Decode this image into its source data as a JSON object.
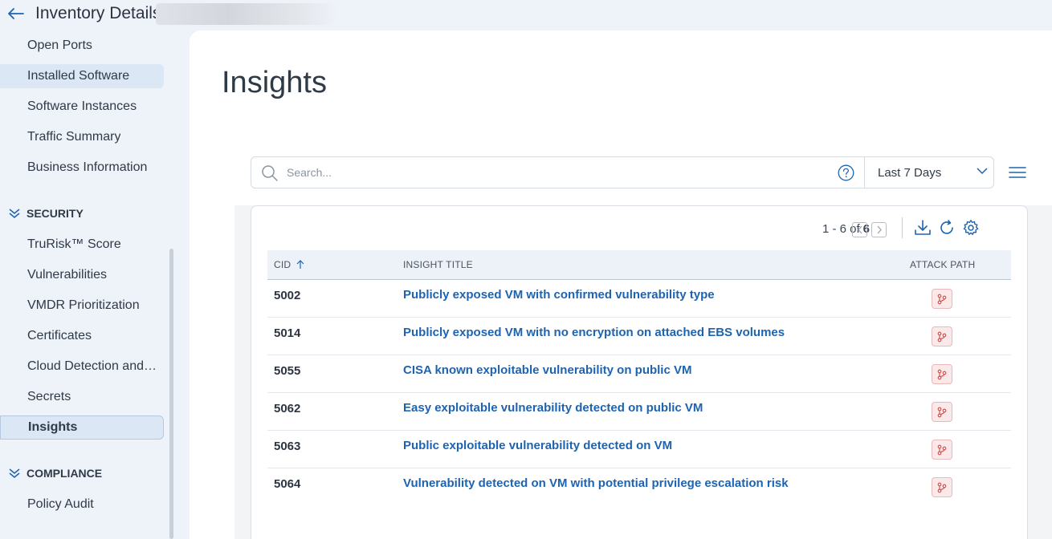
{
  "header": {
    "title": "Inventory Details:"
  },
  "sidebar": {
    "items_top": [
      {
        "label": "Open Ports"
      },
      {
        "label": "Installed Software"
      },
      {
        "label": "Software Instances"
      },
      {
        "label": "Traffic Summary"
      },
      {
        "label": "Business Information"
      }
    ],
    "security_label": "SECURITY",
    "security_items": [
      {
        "label": "TruRisk™ Score"
      },
      {
        "label": "Vulnerabilities"
      },
      {
        "label": "VMDR Prioritization"
      },
      {
        "label": "Certificates"
      },
      {
        "label": "Cloud Detection and Response"
      },
      {
        "label": "Secrets"
      },
      {
        "label": "Insights"
      }
    ],
    "compliance_label": "COMPLIANCE",
    "compliance_items": [
      {
        "label": "Policy Audit"
      }
    ]
  },
  "main": {
    "page_title": "Insights",
    "search": {
      "placeholder": "Search...",
      "value": ""
    },
    "date_range": "Last 7 Days",
    "pager": {
      "range": "1 - 6 of",
      "total": "6"
    },
    "table": {
      "columns": {
        "cid": "CID",
        "title": "INSIGHT TITLE",
        "attack": "ATTACK PATH"
      },
      "rows": [
        {
          "cid": "5002",
          "title": "Publicly exposed VM with confirmed vulnerability type"
        },
        {
          "cid": "5014",
          "title": "Publicly exposed VM with no encryption on attached EBS volumes"
        },
        {
          "cid": "5055",
          "title": "CISA known exploitable vulnerability on public VM"
        },
        {
          "cid": "5062",
          "title": "Easy exploitable vulnerability detected on public VM"
        },
        {
          "cid": "5063",
          "title": "Public exploitable vulnerability detected on VM"
        },
        {
          "cid": "5064",
          "title": "Vulnerability detected on VM with potential privilege escalation risk"
        }
      ]
    }
  },
  "colors": {
    "accent": "#1e63b0",
    "link": "#1e63b0",
    "attack_icon": "#d04848",
    "sidebar_bg": "#eef2f9"
  },
  "icons": [
    "back-arrow-icon",
    "search-icon",
    "help-icon",
    "chevron-down-icon",
    "hamburger-menu-icon",
    "download-icon",
    "refresh-icon",
    "gear-icon",
    "attack-path-icon",
    "sort-ascending-icon"
  ]
}
